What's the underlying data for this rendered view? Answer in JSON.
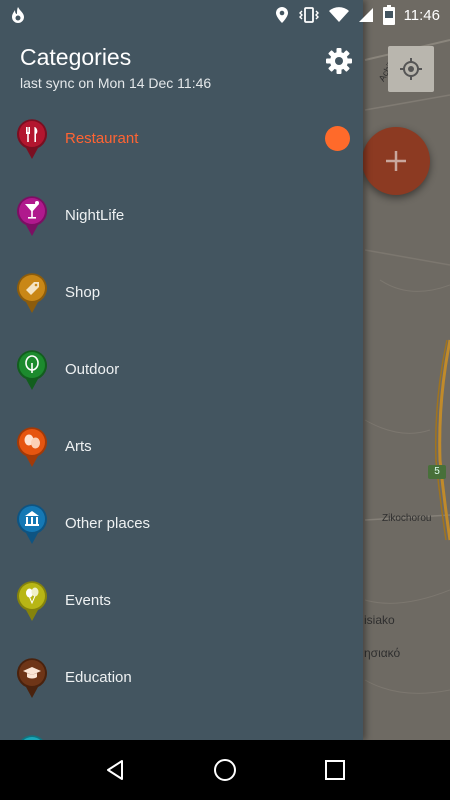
{
  "status_bar": {
    "time": "11:46",
    "icons": [
      "flame-icon",
      "location-icon",
      "vibrate-icon",
      "wifi-icon",
      "signal-icon",
      "battery-icon"
    ]
  },
  "drawer": {
    "title": "Categories",
    "subtitle": "last sync on Mon 14 Dec 11:46",
    "settings_icon": "gear-icon",
    "categories": [
      {
        "label": "Restaurant",
        "color": "#b3162f",
        "icon": "fork-knife-icon",
        "active": true
      },
      {
        "label": "NightLife",
        "color": "#b0198d",
        "icon": "cocktail-icon",
        "active": false
      },
      {
        "label": "Shop",
        "color": "#c98716",
        "icon": "tag-icon",
        "active": false
      },
      {
        "label": "Outdoor",
        "color": "#1c8a2e",
        "icon": "tree-icon",
        "active": false
      },
      {
        "label": "Arts",
        "color": "#e65510",
        "icon": "theater-masks-icon",
        "active": false
      },
      {
        "label": "Other places",
        "color": "#1578b4",
        "icon": "building-icon",
        "active": false
      },
      {
        "label": "Events",
        "color": "#b8b615",
        "icon": "balloons-icon",
        "active": false
      },
      {
        "label": "Education",
        "color": "#6e3517",
        "icon": "graduation-cap-icon",
        "active": false
      },
      {
        "label": "",
        "color": "#19a7b8",
        "icon": "pin-icon",
        "active": false
      }
    ],
    "active_indicator_color": "#ff6a2a"
  },
  "map": {
    "labels": [
      "Achilleos",
      "Zikochorou",
      "isiako",
      "ησιακό"
    ],
    "road_badge": "5",
    "locate_icon": "crosshair-icon",
    "fab_icon": "plus-icon"
  },
  "nav_bar": {
    "icons": [
      "back-icon",
      "home-icon",
      "recents-icon"
    ]
  }
}
